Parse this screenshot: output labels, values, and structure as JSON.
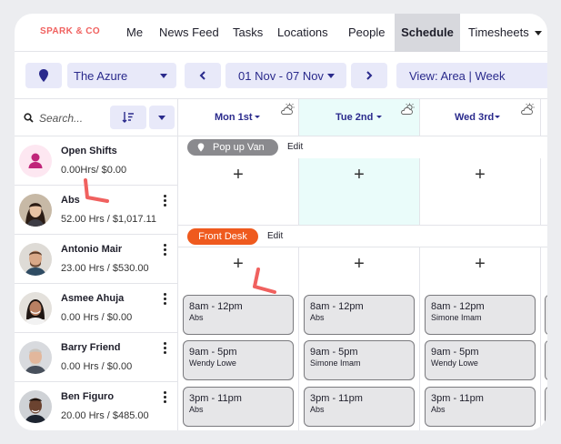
{
  "brand": "SPARK & CO",
  "nav": {
    "items": [
      "Me",
      "News Feed",
      "Tasks",
      "Locations",
      "People",
      "Schedule",
      "Timesheets"
    ],
    "active": "Schedule"
  },
  "filters": {
    "location": "The Azure",
    "date_range": "01 Nov - 07 Nov",
    "view": "View: Area | Week"
  },
  "sidebar": {
    "search_placeholder": "Search...",
    "employees": [
      {
        "name": "Open Shifts",
        "hours": "0.00Hrs/ $0.00",
        "avatar": "person-icon"
      },
      {
        "name": "Abs",
        "hours": "52.00 Hrs / $1,017.11",
        "avatar": "photo"
      },
      {
        "name": "Antonio Mair",
        "hours": "23.00 Hrs / $530.00",
        "avatar": "photo"
      },
      {
        "name": "Asmee Ahuja",
        "hours": "0.00 Hrs / $0.00",
        "avatar": "photo"
      },
      {
        "name": "Barry Friend",
        "hours": "0.00 Hrs / $0.00",
        "avatar": "photo"
      },
      {
        "name": "Ben Figuro",
        "hours": "20.00 Hrs / $485.00",
        "avatar": "photo"
      }
    ]
  },
  "days": [
    {
      "label": "Mon 1st",
      "icon": "cloud-sun-icon"
    },
    {
      "label": "Tue 2nd",
      "icon": "cloud-sun-icon"
    },
    {
      "label": "Wed 3rd",
      "icon": "cloud-sun-icon"
    }
  ],
  "areas": [
    {
      "name": "Pop up Van",
      "edit": "Edit",
      "color": "#8a8a8e"
    },
    {
      "name": "Front Desk",
      "edit": "Edit",
      "color": "#ef5a1e"
    }
  ],
  "shifts": [
    [
      {
        "time": "8am - 12pm",
        "name": "Abs"
      },
      {
        "time": "9am - 5pm",
        "name": "Wendy Lowe"
      },
      {
        "time": "3pm - 11pm",
        "name": "Abs"
      }
    ],
    [
      {
        "time": "8am - 12pm",
        "name": "Abs"
      },
      {
        "time": "9am - 5pm",
        "name": "Simone Imam"
      },
      {
        "time": "3pm - 11pm",
        "name": "Abs"
      }
    ],
    [
      {
        "time": "8am - 12pm",
        "name": "Simone Imam"
      },
      {
        "time": "9am - 5pm",
        "name": "Wendy Lowe"
      },
      {
        "time": "3pm - 11pm",
        "name": "Abs"
      }
    ]
  ],
  "colors": {
    "accent": "#2a2a8c",
    "pill_bg": "#e8e9f9",
    "today_bg": "#eafcfa",
    "brand": "#f0615f",
    "annotation": "#f0615f"
  }
}
